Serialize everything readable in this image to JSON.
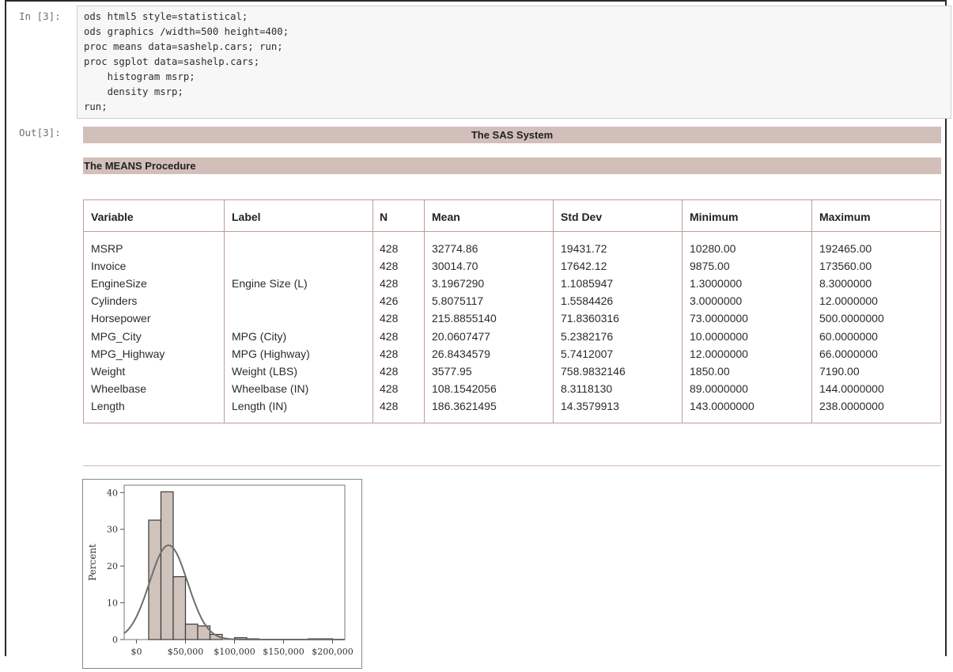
{
  "input_cell": {
    "prompt": "In [3]:",
    "code_lines": [
      "ods html5 style=statistical;",
      "ods graphics /width=500 height=400;",
      "proc means data=sashelp.cars; run;",
      "proc sgplot data=sashelp.cars;",
      "    histogram msrp;",
      "    density msrp;",
      "run;"
    ]
  },
  "output_cell": {
    "prompt": "Out[3]:",
    "system_title": "The SAS System",
    "procedure_title": "The MEANS Procedure",
    "table": {
      "headers": [
        "Variable",
        "Label",
        "N",
        "Mean",
        "Std Dev",
        "Minimum",
        "Maximum"
      ],
      "rows": [
        [
          "MSRP",
          "",
          "428",
          "32774.86",
          "19431.72",
          "10280.00",
          "192465.00"
        ],
        [
          "Invoice",
          "",
          "428",
          "30014.70",
          "17642.12",
          "9875.00",
          "173560.00"
        ],
        [
          "EngineSize",
          "Engine Size (L)",
          "428",
          "3.1967290",
          "1.1085947",
          "1.3000000",
          "8.3000000"
        ],
        [
          "Cylinders",
          "",
          "426",
          "5.8075117",
          "1.5584426",
          "3.0000000",
          "12.0000000"
        ],
        [
          "Horsepower",
          "",
          "428",
          "215.8855140",
          "71.8360316",
          "73.0000000",
          "500.0000000"
        ],
        [
          "MPG_City",
          "MPG (City)",
          "428",
          "20.0607477",
          "5.2382176",
          "10.0000000",
          "60.0000000"
        ],
        [
          "MPG_Highway",
          "MPG (Highway)",
          "428",
          "26.8434579",
          "5.7412007",
          "12.0000000",
          "66.0000000"
        ],
        [
          "Weight",
          "Weight (LBS)",
          "428",
          "3577.95",
          "758.9832146",
          "1850.00",
          "7190.00"
        ],
        [
          "Wheelbase",
          "Wheelbase (IN)",
          "428",
          "108.1542056",
          "8.3118130",
          "89.0000000",
          "144.0000000"
        ],
        [
          "Length",
          "Length (IN)",
          "428",
          "186.3621495",
          "14.3579913",
          "143.0000000",
          "238.0000000"
        ]
      ]
    }
  },
  "chart_data": {
    "type": "bar",
    "ylabel": "Percent",
    "ylim": [
      0,
      42
    ],
    "yticks": [
      0,
      10,
      20,
      30,
      40
    ],
    "xticks": [
      "$0",
      "$50,000",
      "$100,000",
      "$150,000",
      "$200,000"
    ],
    "bins": [
      {
        "start": 0,
        "end": 12500,
        "value": 0
      },
      {
        "start": 12500,
        "end": 25000,
        "value": 32.5
      },
      {
        "start": 25000,
        "end": 37500,
        "value": 40.2
      },
      {
        "start": 37500,
        "end": 50000,
        "value": 17.1
      },
      {
        "start": 50000,
        "end": 62500,
        "value": 4.2
      },
      {
        "start": 62500,
        "end": 75000,
        "value": 3.7
      },
      {
        "start": 75000,
        "end": 87500,
        "value": 1.4
      },
      {
        "start": 87500,
        "end": 100000,
        "value": 0
      },
      {
        "start": 100000,
        "end": 112500,
        "value": 0.5
      },
      {
        "start": 112500,
        "end": 125000,
        "value": 0.2
      },
      {
        "start": 125000,
        "end": 137500,
        "value": 0
      },
      {
        "start": 137500,
        "end": 150000,
        "value": 0
      },
      {
        "start": 150000,
        "end": 162500,
        "value": 0
      },
      {
        "start": 162500,
        "end": 175000,
        "value": 0
      },
      {
        "start": 175000,
        "end": 187500,
        "value": 0.2
      },
      {
        "start": 187500,
        "end": 200000,
        "value": 0.2
      }
    ],
    "density_curve": {
      "mean": 32774.86,
      "std": 19431.72,
      "bin_width": 12500
    },
    "colors": {
      "bar_fill": "#cfc3bc",
      "bar_stroke": "#3a3a3a",
      "curve": "#6e6e6e",
      "band": "#d2bfb9",
      "table_border": "#bf9e97"
    }
  }
}
